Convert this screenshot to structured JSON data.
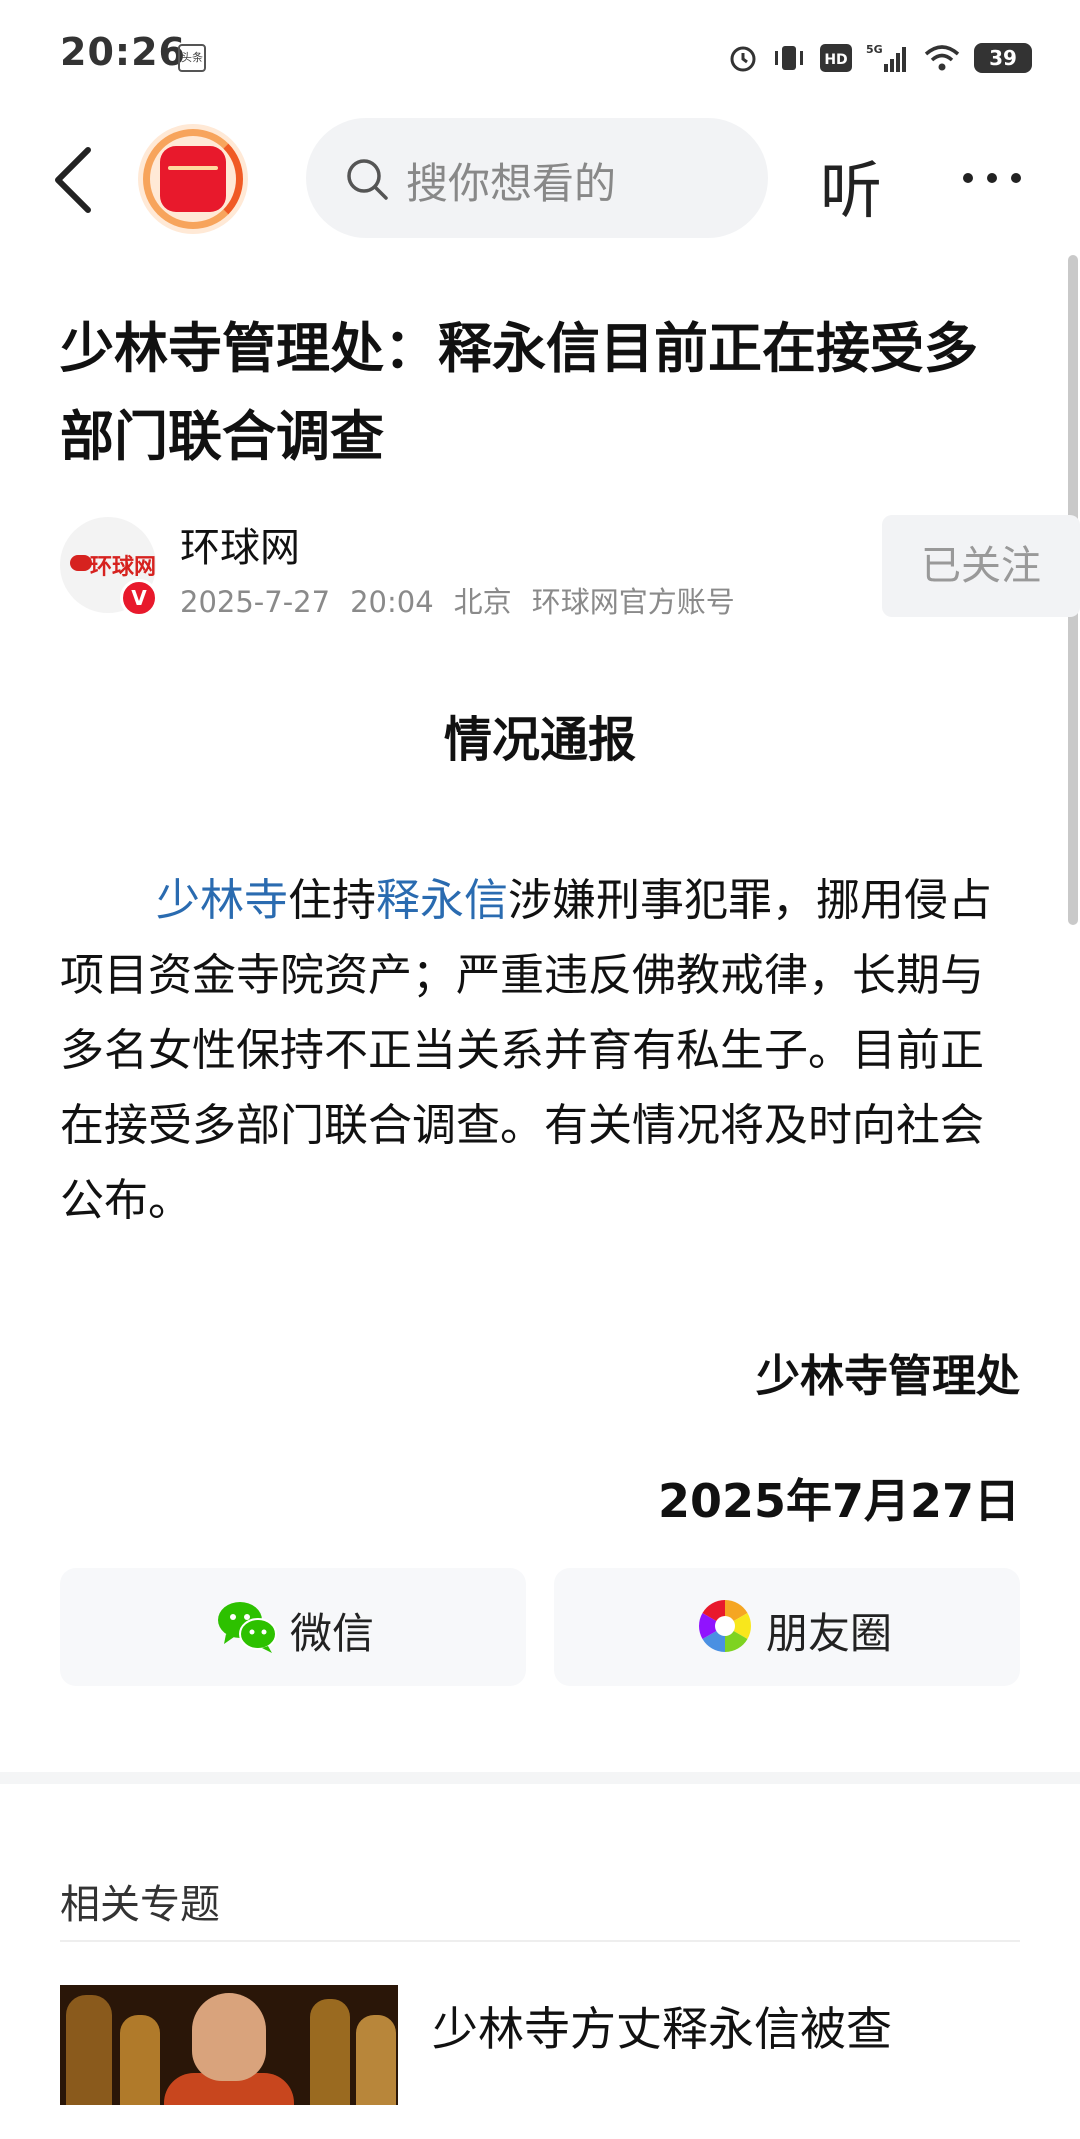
{
  "status_bar": {
    "time": "20:26",
    "app_badge": "头条",
    "network": "5G",
    "hd": "HD",
    "battery": "39",
    "icons": [
      "alarm-icon",
      "vibrate-icon",
      "hd-icon",
      "signal-icon",
      "wifi-icon",
      "battery-icon"
    ]
  },
  "nav": {
    "search_placeholder": "搜你想看的",
    "listen_label": "听",
    "more_label": "···"
  },
  "article": {
    "title": "少林寺管理处：释永信目前正在接受多部门联合调查",
    "author": {
      "name": "环球网",
      "avatar_text": "环球网",
      "verified": "V",
      "date": "2025-7-27",
      "time": "20:04",
      "location": "北京",
      "account_type": "环球网官方账号",
      "follow_label": "已关注"
    },
    "notice_heading": "情况通报",
    "body": {
      "link1": "少林寺",
      "text1": "住持",
      "link2": "释永信",
      "text2": "涉嫌刑事犯罪，挪用侵占项目资金寺院资产；严重违反佛教戒律，长期与多名女性保持不正当关系并育有私生子。目前正在接受多部门联合调查。有关情况将及时向社会公布。"
    },
    "signature_org": "少林寺管理处",
    "signature_date": "2025年7月27日"
  },
  "share": {
    "wechat_label": "微信",
    "moments_label": "朋友圈"
  },
  "related": {
    "heading": "相关专题",
    "items": [
      {
        "title": "少林寺方丈释永信被查"
      }
    ]
  },
  "colors": {
    "link": "#2a6bb0",
    "brand_red": "#e8192c",
    "wechat_green": "#2dc100"
  }
}
